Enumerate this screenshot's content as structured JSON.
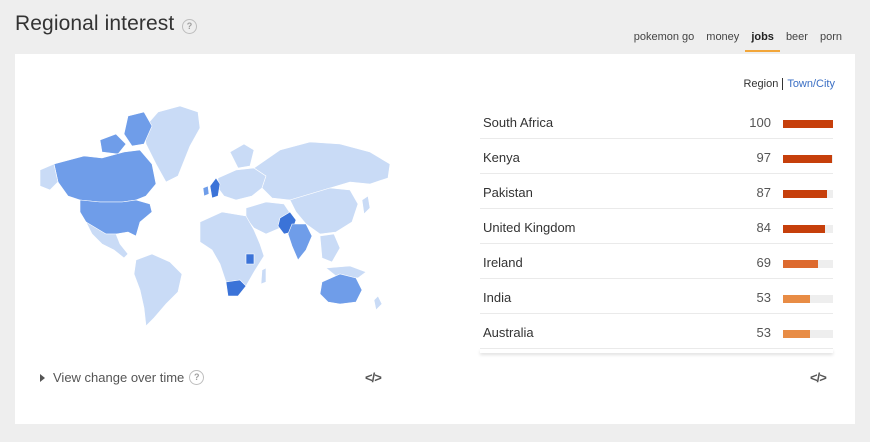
{
  "header": {
    "title": "Regional interest",
    "help_glyph": "?"
  },
  "tabs": [
    {
      "label": "pokemon go",
      "active": false
    },
    {
      "label": "money",
      "active": false
    },
    {
      "label": "jobs",
      "active": true
    },
    {
      "label": "beer",
      "active": false
    },
    {
      "label": "porn",
      "active": false
    }
  ],
  "toggle": {
    "region": "Region",
    "town": "Town/City"
  },
  "regions": [
    {
      "name": "South Africa",
      "value": 100,
      "color": "#c63f0b"
    },
    {
      "name": "Kenya",
      "value": 97,
      "color": "#c63f0b"
    },
    {
      "name": "Pakistan",
      "value": 87,
      "color": "#c63f0b"
    },
    {
      "name": "United Kingdom",
      "value": 84,
      "color": "#c63f0b"
    },
    {
      "name": "Ireland",
      "value": 69,
      "color": "#dd6a2e"
    },
    {
      "name": "India",
      "value": 53,
      "color": "#e88c45"
    },
    {
      "name": "Australia",
      "value": 53,
      "color": "#e88c45"
    }
  ],
  "map": {
    "colors": {
      "light": "#c9dbf6",
      "medium": "#6f9de9",
      "dark": "#3b73d8",
      "ocean": "#ffffff"
    },
    "highlighted_countries": [
      "Canada",
      "United States",
      "United Kingdom",
      "Ireland",
      "South Africa",
      "Kenya",
      "Pakistan",
      "India",
      "Australia"
    ]
  },
  "footer": {
    "view_change": "View change over time",
    "embed_glyph": "</>"
  }
}
